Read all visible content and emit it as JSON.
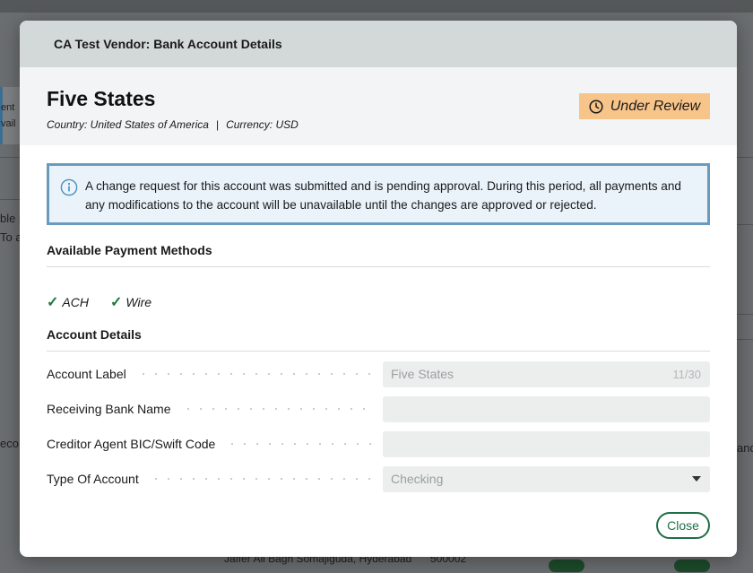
{
  "background": {
    "fragments": [
      "ent",
      "vail",
      "ble p",
      "To a",
      "eco",
      "and",
      "Jaffer Ali Bagh Somajiguda, Hyderabad",
      "500002"
    ]
  },
  "modal": {
    "title": "CA Test Vendor: Bank Account Details",
    "account": {
      "name": "Five States",
      "country_label": "Country: United States of America",
      "separator": "|",
      "currency_label": "Currency: USD",
      "status": "Under Review",
      "status_icon": "clock-icon",
      "status_color": "#f7c48a"
    },
    "info": {
      "icon": "info-icon",
      "message": "A change request for this account was submitted and is pending approval. During this period, all payments and any modifications to the account will be unavailable until the changes are approved or rejected."
    },
    "payment_methods": {
      "title": "Available Payment Methods",
      "items": [
        {
          "check": "✓",
          "label": "ACH"
        },
        {
          "check": "✓",
          "label": "Wire"
        }
      ]
    },
    "account_details": {
      "title": "Account Details",
      "fields": [
        {
          "label": "Account Label",
          "value": "Five States",
          "counter": "11/30"
        },
        {
          "label": "Receiving Bank Name",
          "value": ""
        },
        {
          "label": "Creditor Agent BIC/Swift Code",
          "value": ""
        },
        {
          "label": "Type Of Account",
          "value": "Checking"
        }
      ]
    },
    "close_label": "Close"
  }
}
